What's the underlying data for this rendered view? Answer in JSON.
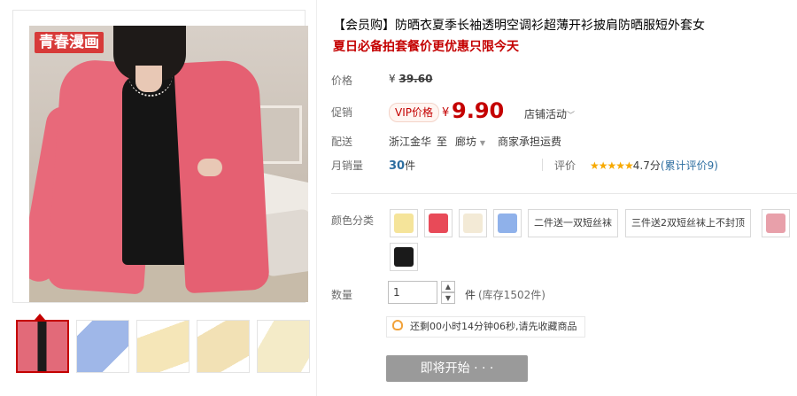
{
  "gallery": {
    "watermark": "青春漫画",
    "thumbnail_colors": [
      "#e26a79",
      "#9fb7e8",
      "#f5e6b8",
      "#f2e1b5",
      "#f4ebc8"
    ]
  },
  "product": {
    "title": "【会员购】防晒衣夏季长袖透明空调衫超薄开衫披肩防晒服短外套女",
    "subtitle": "夏日必备拍套餐价更优惠只限今天"
  },
  "price": {
    "label": "价格",
    "currency": "¥",
    "original": "39.60"
  },
  "promo": {
    "label": "促销",
    "badge": "VIP价格",
    "currency": "¥",
    "price": "9.90",
    "activity": "店铺活动",
    "activity_arrow": "﹀"
  },
  "delivery": {
    "label": "配送",
    "from": "浙江金华",
    "to_word": "至",
    "to": "廊坊",
    "dropdown_arrow": "▼",
    "shipping": "商家承担运费"
  },
  "sales": {
    "label": "月销量",
    "count": "30",
    "unit": "件",
    "rating_label": "评价",
    "stars": "★★★★★",
    "rating_value": "4.7分",
    "review_link": "(累计评价9)"
  },
  "colors": {
    "label": "颜色分类",
    "swatches": [
      "#f5e49a",
      "#e84a58",
      "#f3ead6",
      "#8fb1ea",
      "#e8a0aa",
      "#1a1a1a"
    ],
    "options": [
      "二件送一双短丝袜",
      "三件送2双短丝袜上不封顶"
    ]
  },
  "quantity": {
    "label": "数量",
    "value": "1",
    "up": "▲",
    "down": "▼",
    "unit": "件",
    "stock": "(库存1502件)"
  },
  "notice": {
    "text": "还剩00小时14分钟06秒,请先收藏商品"
  },
  "buy_button": {
    "label": "即将开始 · · ·"
  }
}
